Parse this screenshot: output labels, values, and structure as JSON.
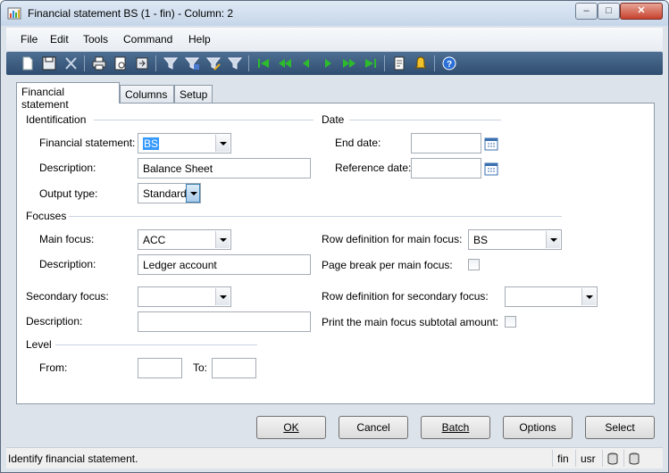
{
  "window": {
    "title": "Financial statement BS (1 - fin) - Column: 2",
    "controls": {
      "minimize": "–",
      "maximize": "□",
      "close": "✕"
    }
  },
  "menu": [
    "File",
    "Edit",
    "Tools",
    "Command",
    "Help"
  ],
  "toolbar": {
    "icons": [
      "new-icon",
      "save-icon",
      "delete-icon",
      "print-icon",
      "print-preview-icon",
      "export-icon",
      "filter-icon",
      "filter-by-selection-icon",
      "advanced-filter-icon",
      "remove-filter-icon",
      "first-record-icon",
      "previous-page-icon",
      "previous-record-icon",
      "next-record-icon",
      "next-page-icon",
      "last-record-icon",
      "document-icon",
      "alert-icon",
      "help-icon"
    ]
  },
  "tabs": [
    "Financial statement",
    "Columns",
    "Setup"
  ],
  "identification": {
    "title": "Identification",
    "financial_statement_label": "Financial statement:",
    "financial_statement_value": "BS",
    "description_label": "Description:",
    "description_value": "Balance Sheet",
    "output_type_label": "Output type:",
    "output_type_value": "Standard"
  },
  "date": {
    "title": "Date",
    "end_date_label": "End date:",
    "end_date_value": "",
    "reference_date_label": "Reference date:",
    "reference_date_value": ""
  },
  "focuses": {
    "title": "Focuses",
    "main_focus_label": "Main focus:",
    "main_focus_value": "ACC",
    "main_description_label": "Description:",
    "main_description_value": "Ledger account",
    "row_def_main_label": "Row definition for main focus:",
    "row_def_main_value": "BS",
    "page_break_label": "Page break per main focus:",
    "page_break_checked": false,
    "secondary_focus_label": "Secondary focus:",
    "secondary_focus_value": "",
    "secondary_description_label": "Description:",
    "secondary_description_value": "",
    "row_def_secondary_label": "Row definition for secondary focus:",
    "row_def_secondary_value": "",
    "print_subtotal_label": "Print the main focus subtotal amount:",
    "print_subtotal_checked": false
  },
  "level": {
    "title": "Level",
    "from_label": "From:",
    "from_value": "",
    "to_label": "To:",
    "to_value": ""
  },
  "buttons": {
    "ok": "OK",
    "cancel": "Cancel",
    "batch": "Batch",
    "options": "Options",
    "select": "Select"
  },
  "status": {
    "message": "Identify financial statement.",
    "company": "fin",
    "layer": "usr"
  },
  "colors": {
    "toolbar_bg": "#3a5a80",
    "selection": "#3399ff",
    "nav_green": "#22a822"
  }
}
